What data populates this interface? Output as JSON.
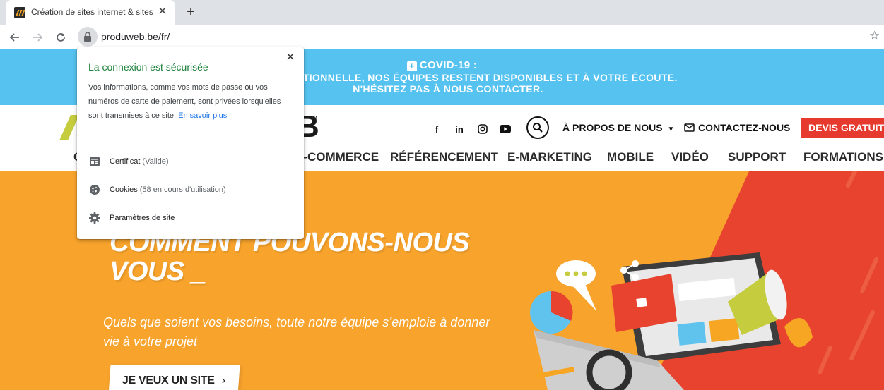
{
  "browser": {
    "tab": {
      "title": "Création de sites internet & sites",
      "close": "✕"
    },
    "new_tab": "+",
    "url": "produweb.be/fr/"
  },
  "site_info_popup": {
    "title": "La connexion est sécurisée",
    "description": "Vos informations, comme vos mots de passe ou vos numéros de carte de paiement, sont privées lorsqu'elles sont transmises à ce site.",
    "learn_more": "En savoir plus",
    "close": "✕",
    "items": [
      {
        "label": "Certificat",
        "sub": "(Valide)",
        "icon": "certificate-icon"
      },
      {
        "label": "Cookies",
        "sub": "(58 en cours d'utilisation)",
        "icon": "cookie-icon"
      },
      {
        "label": "Paramètres de site",
        "sub": "",
        "icon": "gear-icon"
      }
    ]
  },
  "covid_banner": {
    "title": "COVID-19 :",
    "line1": "PÉRIODE EXCEPTIONNELLE, NOS ÉQUIPES RESTENT DISPONIBLES ET À VOTRE ÉCOUTE.",
    "line2": "N'HÉSITEZ PAS À NOUS CONTACTER."
  },
  "header": {
    "logo_letter": "B",
    "logo_tm": "™",
    "social": [
      {
        "name": "facebook-icon",
        "glyph": "f"
      },
      {
        "name": "linkedin-icon",
        "glyph": "in"
      },
      {
        "name": "instagram-icon",
        "glyph": ""
      },
      {
        "name": "youtube-icon",
        "glyph": ""
      }
    ],
    "apropos": "À PROPOS DE NOUS",
    "contact": "CONTACTEZ-NOUS",
    "devis": "DEVIS GRATUIT",
    "menu_partial": "C",
    "menu": [
      "E-COMMERCE",
      "RÉFÉRENCEMENT",
      "E-MARKETING",
      "MOBILE",
      "VIDÉO",
      "SUPPORT",
      "FORMATIONS"
    ]
  },
  "hero": {
    "title_line1": "COMMENT POUVONS-NOUS",
    "title_line2": "VOUS _",
    "subtitle_line1": "Quels que soient vos besoins, toute notre équipe s’emploie à donner",
    "subtitle_line2": "vie à votre projet",
    "cta": "JE VEUX UN SITE",
    "cta_arrow": "›"
  },
  "colors": {
    "covid_blue": "#56c2ef",
    "hero_orange": "#f8a32c",
    "hero_red": "#e8432f",
    "devis_red": "#e63a2e",
    "secure_green": "#188038",
    "link_blue": "#1a73e8"
  }
}
